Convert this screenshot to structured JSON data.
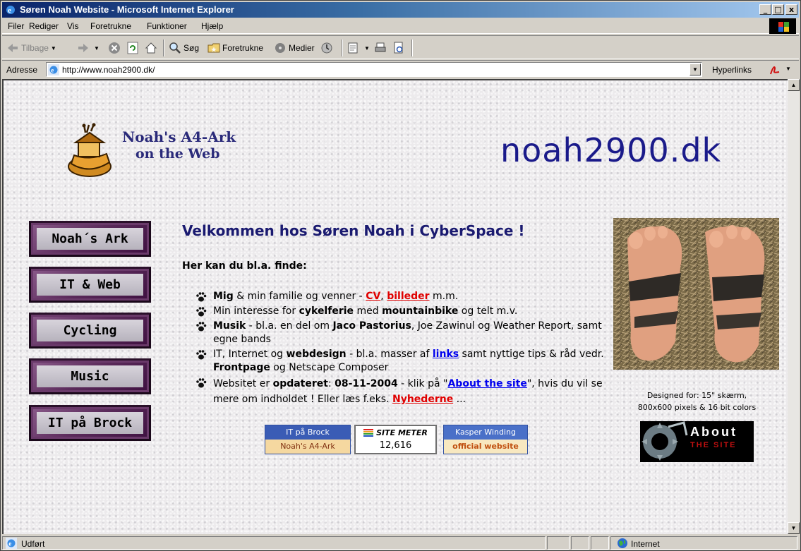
{
  "window": {
    "title": "Søren Noah Website - Microsoft Internet Explorer",
    "minimize": "_",
    "maximize": "□",
    "close": "x"
  },
  "menu": [
    "Filer",
    "Rediger",
    "Vis",
    "Foretrukne",
    "Funktioner",
    "Hjælp"
  ],
  "toolbar": {
    "back": "Tilbage",
    "search": "Søg",
    "favorites": "Foretrukne",
    "media": "Medier"
  },
  "address": {
    "label": "Adresse",
    "url": "http://www.noah2900.dk/",
    "links": "Hyperlinks"
  },
  "page": {
    "logo_line1": "Noah's A4-Ark",
    "logo_line2": "on the Web",
    "site_name": "noah2900.dk",
    "nav": [
      "Noah´s Ark",
      "IT & Web",
      "Cycling",
      "Music",
      "IT på Brock"
    ],
    "welcome": "Velkommen hos Søren Noah i CyberSpace !",
    "intro": "Her kan du bl.a. finde:",
    "bullet1": {
      "b": "Mig",
      "t1": " & min familie og venner - ",
      "cv": "CV",
      "comma": ", ",
      "pics": "billeder",
      "t2": " m.m."
    },
    "bullet2": {
      "t1": "Min interesse for ",
      "b1": "cykelferie",
      "t2": " med ",
      "b2": "mountainbike",
      "t3": " og telt m.v."
    },
    "bullet3": {
      "b1": "Musik",
      "t1": " - bl.a. en del om ",
      "b2": "Jaco Pastorius",
      "t2": ", Joe Zawinul og Weather Report, samt egne bands"
    },
    "bullet4": {
      "t1": "IT, Internet og ",
      "b1": "webdesign",
      "t2": " - bl.a. masser af ",
      "links": "links",
      "t3": " samt nyttige tips & råd vedr. ",
      "b2": "Frontpage",
      "t4": " og Netscape Composer"
    },
    "bullet5": {
      "t1": "Websitet er ",
      "b1": "opdateret",
      "t2": ": ",
      "date": "08-11-2004",
      "t3": " - klik på \"",
      "about": "About the site",
      "t4": "\", hvis du vil se mere om indholdet ! Eller læs f.eks. ",
      "news": "Nyhederne",
      "t5": " ..."
    },
    "badges": {
      "brock_top": "IT på Brock",
      "brock_bottom": "Noah's A4-Ark",
      "meter_top": "SITE METER",
      "meter_count": "12,616",
      "kasper_top": "Kasper Winding",
      "kasper_bottom": "official website"
    },
    "designed_line1": "Designed for: 15\" skærm,",
    "designed_line2": "800x600 pixels & 16 bit colors",
    "about_line1": "About",
    "about_line2": "THE SITE"
  },
  "status": {
    "text": "Udført",
    "zone": "Internet"
  }
}
